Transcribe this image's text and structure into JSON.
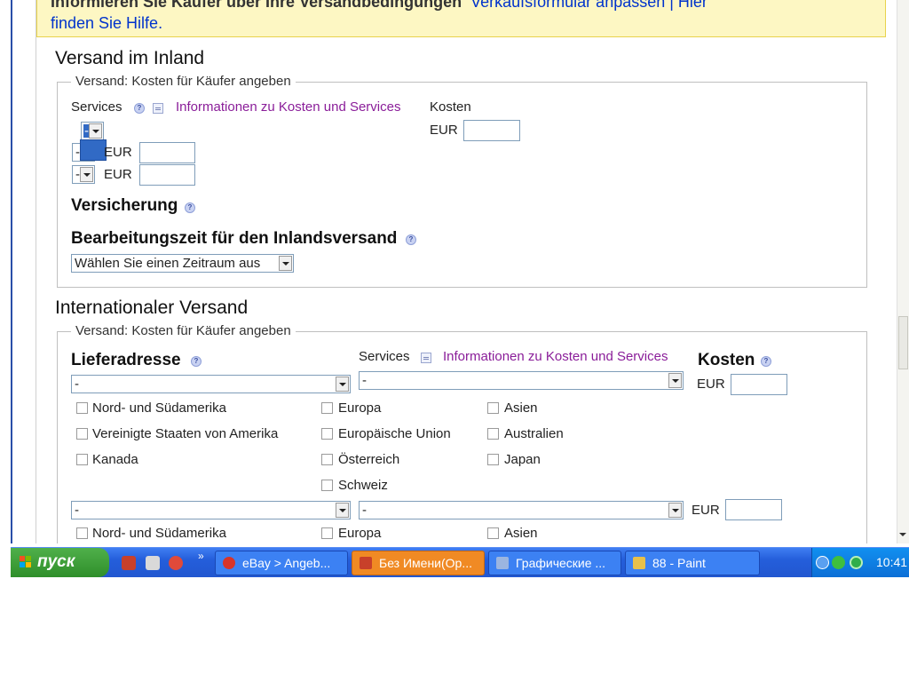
{
  "banner": {
    "line1_text": "Informieren Sie Käufer über Ihre Versandbedingungen",
    "line1_link": "Verkaufsformular anpassen | Hier",
    "line2_link": "finden Sie Hilfe."
  },
  "domestic": {
    "heading": "Versand im Inland",
    "legend": "Versand: Kosten für Käufer angeben",
    "services_label": "Services",
    "info_link": "Informationen zu Kosten und Services",
    "cost_label": "Kosten",
    "currency": "EUR",
    "service_select_value": "-",
    "rows": [
      {
        "select_value": "-",
        "currency": "EUR"
      },
      {
        "select_value": "-",
        "currency": "EUR"
      }
    ],
    "insurance_label": "Versicherung",
    "handling_label": "Bearbeitungszeit für den Inlandsversand",
    "handling_select_value": "Wählen Sie einen Zeitraum aus"
  },
  "international": {
    "heading": "Internationaler Versand",
    "legend": "Versand: Kosten für Käufer angeben",
    "address_label": "Lieferadresse",
    "services_label": "Services",
    "info_link": "Informationen zu Kosten und Services",
    "cost_label": "Kosten",
    "currency": "EUR",
    "address_select_value": "-",
    "service_select_value": "-",
    "regions": [
      "Nord- und Südamerika",
      "Europa",
      "Asien",
      "Vereinigte Staaten von Amerika",
      "Europäische Union",
      "Australien",
      "Kanada",
      "Österreich",
      "Japan",
      "Schweiz"
    ],
    "row2": {
      "address_select_value": "-",
      "service_select_value": "-",
      "currency": "EUR",
      "regions": [
        "Nord- und Südamerika",
        "Europa",
        "Asien"
      ]
    }
  },
  "taskbar": {
    "start_label": "пуск",
    "more_indicator": "»",
    "tasks": [
      {
        "label": "eBay > Angeb..."
      },
      {
        "label": "Без Имени(Ор..."
      },
      {
        "label": "Графические ..."
      },
      {
        "label": "88 - Paint"
      }
    ],
    "clock": "10:41"
  }
}
